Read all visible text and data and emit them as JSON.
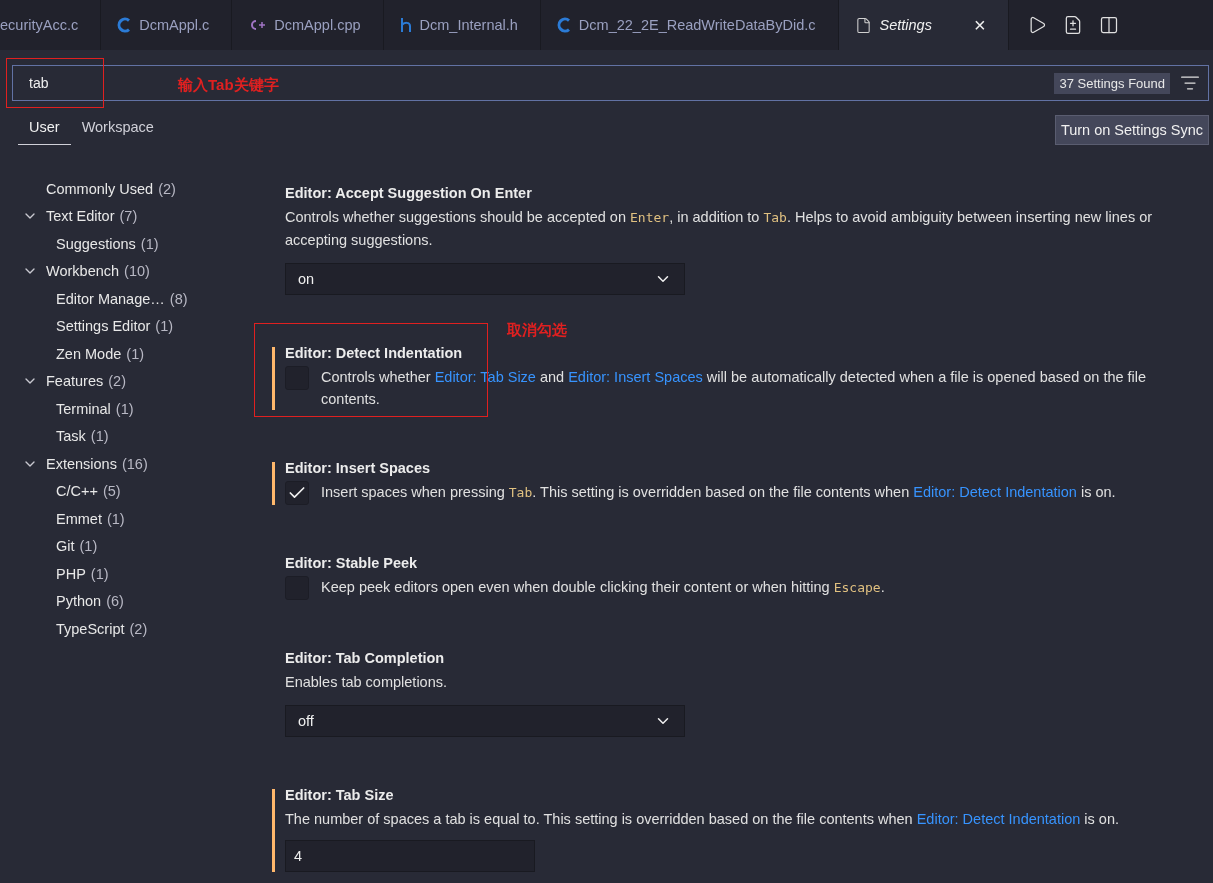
{
  "tabs": [
    {
      "label": "ecurityAcc.c",
      "selected": false
    },
    {
      "label": "DcmAppl.c",
      "kind": "c",
      "selected": false
    },
    {
      "label": "DcmAppl.cpp",
      "kind": "cpp",
      "selected": false
    },
    {
      "label": "Dcm_Internal.h",
      "kind": "h",
      "selected": false
    },
    {
      "label": "Dcm_22_2E_ReadWriteDataByDid.c",
      "kind": "c",
      "selected": false
    },
    {
      "label": "Settings",
      "kind": "file",
      "selected": true,
      "close": "×"
    }
  ],
  "search": {
    "value": "tab",
    "result_count": "37 Settings Found",
    "annotation": "输入Tab关键字"
  },
  "scope_tabs": [
    {
      "label": "User",
      "selected": true
    },
    {
      "label": "Workspace",
      "selected": false
    }
  ],
  "sync_button": "Turn on Settings Sync",
  "toc": [
    {
      "label": "Commonly Used",
      "count": "(2)"
    },
    {
      "label": "Text Editor",
      "count": "(7)",
      "expanded": true,
      "children": [
        {
          "label": "Suggestions",
          "count": "(1)"
        }
      ]
    },
    {
      "label": "Workbench",
      "count": "(10)",
      "expanded": true,
      "children": [
        {
          "label": "Editor Manage…",
          "count": "(8)"
        },
        {
          "label": "Settings Editor",
          "count": "(1)"
        },
        {
          "label": "Zen Mode",
          "count": "(1)"
        }
      ]
    },
    {
      "label": "Features",
      "count": "(2)",
      "expanded": true,
      "children": [
        {
          "label": "Terminal",
          "count": "(1)"
        },
        {
          "label": "Task",
          "count": "(1)"
        }
      ]
    },
    {
      "label": "Extensions",
      "count": "(16)",
      "expanded": true,
      "children": [
        {
          "label": "C/C++",
          "count": "(5)"
        },
        {
          "label": "Emmet",
          "count": "(1)"
        },
        {
          "label": "Git",
          "count": "(1)"
        },
        {
          "label": "PHP",
          "count": "(1)"
        },
        {
          "label": "Python",
          "count": "(6)"
        },
        {
          "label": "TypeScript",
          "count": "(2)"
        }
      ]
    }
  ],
  "settings": [
    {
      "kind": "dropdown",
      "category": "Editor: ",
      "title": "Accept Suggestion On Enter",
      "modified": false,
      "description": [
        {
          "kind": "text",
          "text": "Controls whether suggestions should be accepted on "
        },
        {
          "kind": "code",
          "text": "Enter"
        },
        {
          "kind": "text",
          "text": ", in addition to "
        },
        {
          "kind": "code",
          "text": "Tab"
        },
        {
          "kind": "text",
          "text": ". Helps to avoid ambiguity between inserting new lines or accepting suggestions."
        }
      ],
      "value": "on"
    },
    {
      "kind": "checkbox",
      "category": "Editor: ",
      "title": "Detect Indentation",
      "modified": true,
      "checked": false,
      "annotation": "取消勾选",
      "description": [
        {
          "kind": "text",
          "text": "Controls whether "
        },
        {
          "kind": "link",
          "text": "Editor: Tab Size"
        },
        {
          "kind": "text",
          "text": " and "
        },
        {
          "kind": "link",
          "text": "Editor: Insert Spaces"
        },
        {
          "kind": "text",
          "text": " will be automatically detected when a file is opened based on the file contents."
        }
      ]
    },
    {
      "kind": "checkbox",
      "category": "Editor: ",
      "title": "Insert Spaces",
      "modified": true,
      "checked": true,
      "description": [
        {
          "kind": "text",
          "text": "Insert spaces when pressing "
        },
        {
          "kind": "code",
          "text": "Tab"
        },
        {
          "kind": "text",
          "text": ". This setting is overridden based on the file contents when "
        },
        {
          "kind": "link",
          "text": "Editor: Detect Indentation"
        },
        {
          "kind": "text",
          "text": " is on."
        }
      ]
    },
    {
      "kind": "checkbox",
      "category": "Editor: ",
      "title": "Stable Peek",
      "modified": false,
      "checked": false,
      "description": [
        {
          "kind": "text",
          "text": "Keep peek editors open even when double clicking their content or when hitting "
        },
        {
          "kind": "code",
          "text": "Escape"
        },
        {
          "kind": "text",
          "text": "."
        }
      ]
    },
    {
      "kind": "dropdown",
      "category": "Editor: ",
      "title": "Tab Completion",
      "modified": false,
      "description": [
        {
          "kind": "text",
          "text": "Enables tab completions."
        }
      ],
      "value": "off"
    },
    {
      "kind": "number",
      "category": "Editor: ",
      "title": "Tab Size",
      "modified": true,
      "description": [
        {
          "kind": "text",
          "text": "The number of spaces a tab is equal to. This setting is overridden based on the file contents when "
        },
        {
          "kind": "link",
          "text": "Editor: Detect Indentation"
        },
        {
          "kind": "text",
          "text": " is on."
        }
      ],
      "value": "4"
    }
  ]
}
